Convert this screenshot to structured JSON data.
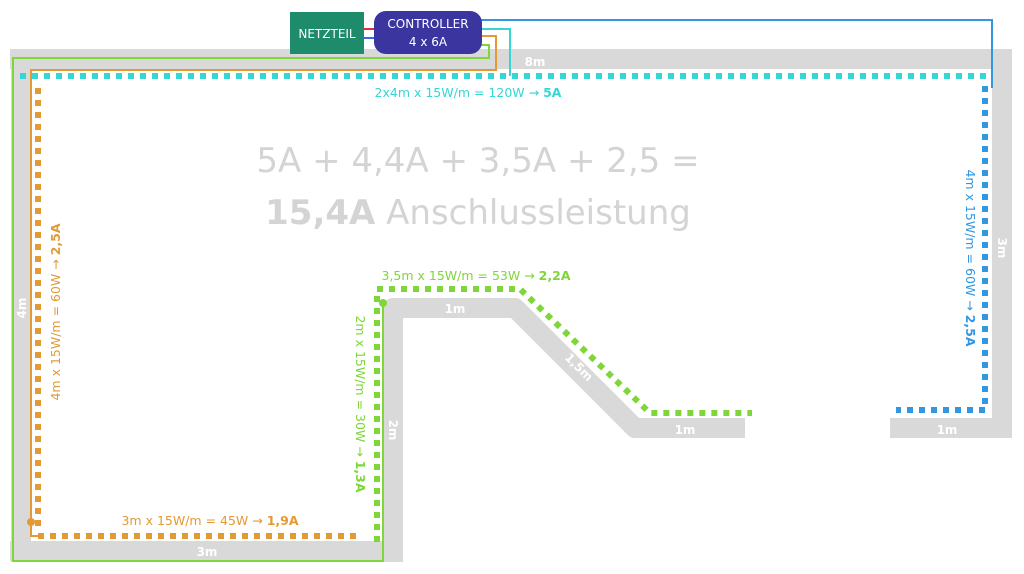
{
  "colors": {
    "wall": "#d9d9d9",
    "green": "#7ed63a",
    "orange": "#e39a34",
    "cyan": "#36d6d4",
    "blue": "#3297e0",
    "netzteil": "#1e8c6a",
    "controller": "#3b35a0",
    "total": "#d4d4d4"
  },
  "devices": {
    "netzteil": "NETZTEIL",
    "controller_line1": "CONTROLLER",
    "controller_line2": "4 x 6A"
  },
  "total": {
    "line1": "5A + 4,4A + 3,5A + 2,5 =",
    "line2_bold": "15,4A",
    "line2_rest": " Anschlussleistung"
  },
  "walls": {
    "top": "8m",
    "right": "3m",
    "left": "4m",
    "bottom": "3m",
    "inner_vertical": "2m",
    "inner_top": "1m",
    "diagonal": "1,5m",
    "inner_bottom": "1m",
    "right_bottom": "1m"
  },
  "segments": {
    "top": {
      "text": "2x4m x 15W/m = 120W → ",
      "bold": "5A"
    },
    "right": {
      "text": "4m x 15W/m = 60W → ",
      "bold": "2,5A"
    },
    "left": {
      "text": "4m x 15W/m = 60W → ",
      "bold": "2,5A"
    },
    "bottom": {
      "text": "3m x 15W/m = 45W → ",
      "bold": "1,9A"
    },
    "inner_vertical": {
      "text": "2m x 15W/m = 30W → ",
      "bold": "1,3A"
    },
    "inner_top": {
      "text": "3,5m x 15W/m = 53W → ",
      "bold": "2,2A"
    }
  }
}
